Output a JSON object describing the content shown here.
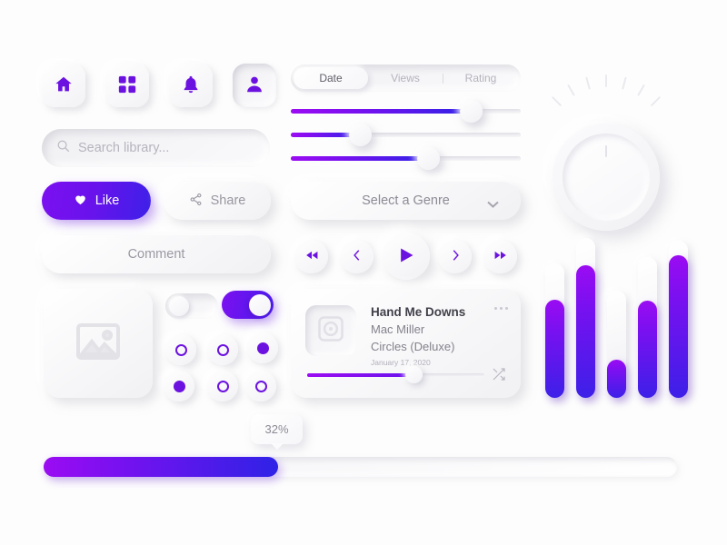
{
  "nav": {
    "items": [
      {
        "name": "home",
        "icon": "home-icon",
        "active": false
      },
      {
        "name": "grid",
        "icon": "grid-icon",
        "active": false
      },
      {
        "name": "notifications",
        "icon": "bell-icon",
        "active": false
      },
      {
        "name": "profile",
        "icon": "user-icon",
        "active": true
      }
    ]
  },
  "search": {
    "placeholder": "Search library...",
    "value": "",
    "icon": "search-icon"
  },
  "actions": {
    "like_label": "Like",
    "share_label": "Share",
    "comment_label": "Comment"
  },
  "segmented": {
    "tabs": [
      {
        "label": "Date",
        "active": true
      },
      {
        "label": "Views",
        "active": false
      },
      {
        "label": "Rating",
        "active": false
      }
    ]
  },
  "sliders": [
    {
      "name": "slider-1",
      "value": 79
    },
    {
      "name": "slider-2",
      "value": 30
    },
    {
      "name": "slider-3",
      "value": 60
    }
  ],
  "select": {
    "label": "Select a Genre",
    "icon": "chevron-down-icon"
  },
  "media_controls": [
    {
      "name": "rewind",
      "icon": "rewind-icon"
    },
    {
      "name": "previous",
      "icon": "chevron-left-icon"
    },
    {
      "name": "play",
      "icon": "play-icon"
    },
    {
      "name": "next",
      "icon": "chevron-right-icon"
    },
    {
      "name": "forward",
      "icon": "fast-forward-icon"
    }
  ],
  "music_card": {
    "title": "Hand Me Downs",
    "artist": "Mac Miller",
    "album": "Circles (Deluxe)",
    "date": "January 17, 2020",
    "progress": 60,
    "art_icon": "disc-icon",
    "menu_icon": "more-icon",
    "shuffle_icon": "shuffle-icon"
  },
  "toggles": [
    {
      "name": "toggle-off",
      "on": false
    },
    {
      "name": "toggle-on",
      "on": true
    }
  ],
  "radios": [
    {
      "name": "radio-1",
      "on": false
    },
    {
      "name": "radio-2",
      "on": false
    },
    {
      "name": "radio-3",
      "on": true
    },
    {
      "name": "radio-4",
      "on": true
    },
    {
      "name": "radio-5",
      "on": false
    },
    {
      "name": "radio-6",
      "on": false
    }
  ],
  "image_placeholder": {
    "icon": "image-icon"
  },
  "knob": {
    "name": "volume-knob",
    "ticks": 7
  },
  "bars": [
    {
      "name": "bar-1",
      "fill_percent": 73
    },
    {
      "name": "bar-2",
      "fill_percent": 83
    },
    {
      "name": "bar-3",
      "fill_percent": 36
    },
    {
      "name": "bar-4",
      "fill_percent": 69
    },
    {
      "name": "bar-5",
      "fill_percent": 91
    }
  ],
  "progress": {
    "percent": 32,
    "label": "32%"
  },
  "colors": {
    "accent_purple": "#7b10f0",
    "accent_blue": "#3d20e8",
    "icon_purple": "#6c12e0",
    "surface": "#fdfdfd",
    "text_muted": "#9a9aa4"
  }
}
